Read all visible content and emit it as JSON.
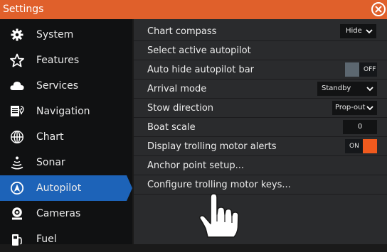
{
  "window": {
    "title": "Settings"
  },
  "sidebar": {
    "items": [
      {
        "label": "System",
        "icon": "gear-icon"
      },
      {
        "label": "Features",
        "icon": "star-icon"
      },
      {
        "label": "Services",
        "icon": "cloud-icon"
      },
      {
        "label": "Navigation",
        "icon": "navigation-icon"
      },
      {
        "label": "Chart",
        "icon": "globe-icon"
      },
      {
        "label": "Sonar",
        "icon": "sonar-icon"
      },
      {
        "label": "Autopilot",
        "icon": "autopilot-icon",
        "active": true
      },
      {
        "label": "Cameras",
        "icon": "camera-icon"
      },
      {
        "label": "Fuel",
        "icon": "fuel-icon"
      }
    ]
  },
  "settings": {
    "rows": [
      {
        "label": "Chart compass",
        "control": {
          "type": "dropdown",
          "value": "Hide"
        }
      },
      {
        "label": "Select active autopilot"
      },
      {
        "label": "Auto hide autopilot bar",
        "control": {
          "type": "toggle",
          "value": "OFF",
          "state": "off"
        }
      },
      {
        "label": "Arrival mode",
        "control": {
          "type": "dropdown",
          "value": "Standby"
        }
      },
      {
        "label": "Stow direction",
        "control": {
          "type": "dropdown",
          "value": "Prop-out"
        }
      },
      {
        "label": "Boat scale",
        "control": {
          "type": "number",
          "value": "0"
        }
      },
      {
        "label": "Display trolling motor alerts",
        "control": {
          "type": "toggle",
          "value": "ON",
          "state": "on"
        }
      },
      {
        "label": "Anchor point setup..."
      },
      {
        "label": "Configure trolling motor keys..."
      }
    ]
  },
  "colors": {
    "title_bar": "#e0602b",
    "accent_blue": "#1d63b8",
    "toggle_on": "#f05a1e",
    "toggle_off": "#5c6770"
  },
  "overlay": {
    "icon": "pointing-hand-icon"
  }
}
